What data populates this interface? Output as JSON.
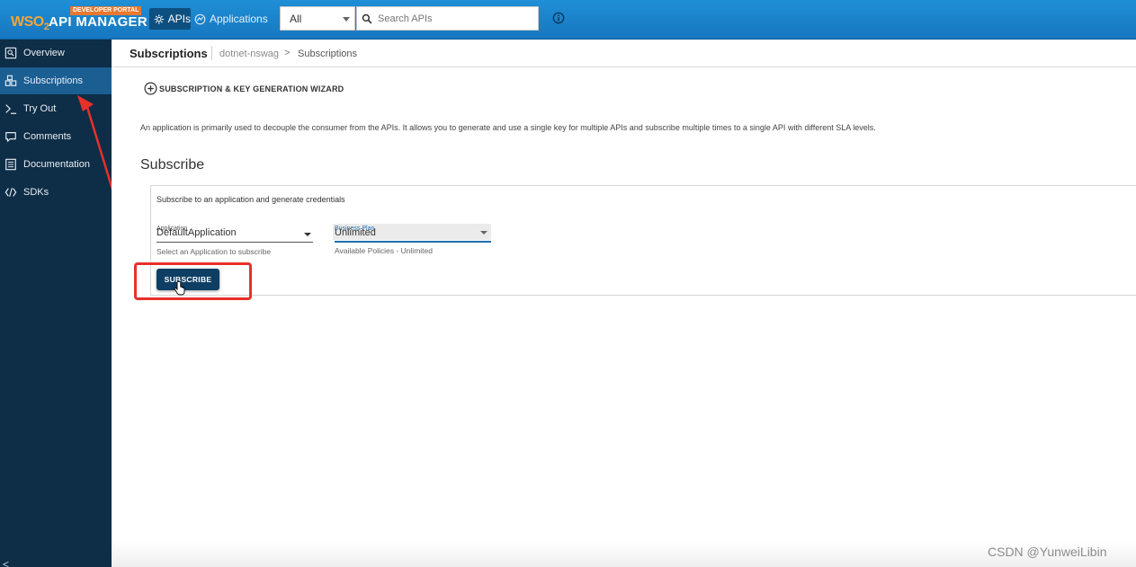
{
  "header": {
    "logo_wso2": "WSO",
    "logo_wso2_sub": "2",
    "logo_product": "API MANAGER",
    "logo_badge": "DEVELOPER PORTAL",
    "nav_apis": "APIs",
    "nav_applications": "Applications",
    "filter_selected": "All",
    "search_placeholder": "Search APIs"
  },
  "sidebar": {
    "items": [
      {
        "label": "Overview",
        "icon": "overview-icon",
        "active": false
      },
      {
        "label": "Subscriptions",
        "icon": "subscriptions-icon",
        "active": true
      },
      {
        "label": "Try Out",
        "icon": "terminal-icon",
        "active": false
      },
      {
        "label": "Comments",
        "icon": "comment-icon",
        "active": false
      },
      {
        "label": "Documentation",
        "icon": "document-icon",
        "active": false
      },
      {
        "label": "SDKs",
        "icon": "code-icon",
        "active": false
      }
    ],
    "collapse": "<"
  },
  "breadcrumb": {
    "title": "Subscriptions",
    "api_name": "dotnet-nswag",
    "separator": ">",
    "current": "Subscriptions"
  },
  "main": {
    "wizard_label": "SUBSCRIPTION & KEY GENERATION WIZARD",
    "description": "An application is primarily used to decouple the consumer from the APIs. It allows you to generate and use a single key for multiple APIs and subscribe multiple times to a single API with different SLA levels.",
    "subscribe_heading": "Subscribe",
    "card": {
      "hint": "Subscribe to an application and generate credentials",
      "application_label": "Application",
      "application_value": "DefaultApplication",
      "application_help": "Select an Application to subscribe",
      "plan_label": "Business Plan",
      "plan_value": "Unlimited",
      "plan_help": "Available Policies - Unlimited",
      "subscribe_button": "SUBSCRIBE"
    }
  },
  "watermark": "CSDN @YunweiLibin",
  "colors": {
    "topbar": "#1677bf",
    "sidebar": "#0e2d47",
    "sidebar_active": "#1a5e92",
    "button": "#0e3e63",
    "highlight": "#e8302a",
    "brand_orange": "#f7a437"
  }
}
